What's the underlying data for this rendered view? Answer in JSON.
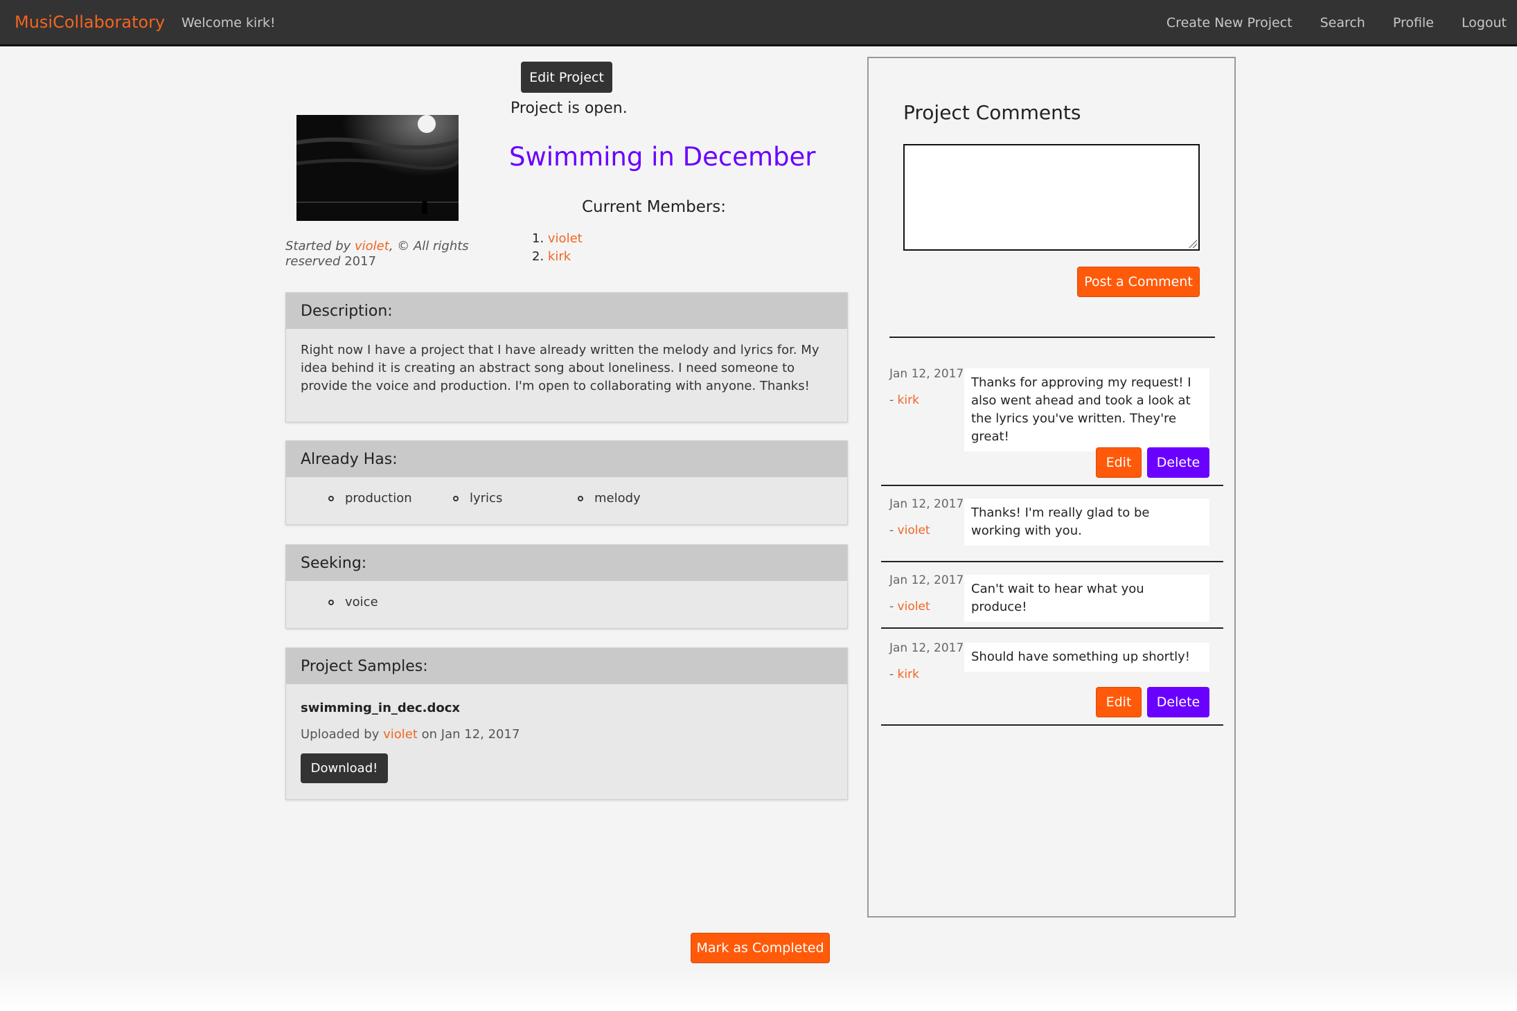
{
  "nav": {
    "brand": "MusiCollaboratory",
    "welcome": "Welcome kirk!",
    "links": [
      "Create New Project",
      "Search",
      "Profile",
      "Logout"
    ]
  },
  "project": {
    "edit_label": "Edit Project",
    "status": "Project is open.",
    "title": "Swimming in December",
    "started_prefix": "Started by ",
    "started_user": "violet",
    "started_suffix": ", © All rights reserved",
    "year": " 2017",
    "members_heading": "Current Members:",
    "members": [
      "violet",
      "kirk"
    ]
  },
  "description": {
    "heading": "Description:",
    "text": "Right now I have a project that I have already written the melody and lyrics for. My idea behind it is creating an abstract song about loneliness. I need someone to provide the voice and production. I'm open to collaborating with anyone. Thanks!"
  },
  "already_has": {
    "heading": "Already Has:",
    "items": [
      "production",
      "lyrics",
      "melody"
    ]
  },
  "seeking": {
    "heading": "Seeking:",
    "items": [
      "voice"
    ]
  },
  "samples": {
    "heading": "Project Samples:",
    "file_name": "swimming_in_dec.docx",
    "uploaded_prefix": "Uploaded by ",
    "uploaded_user": "violet",
    "uploaded_suffix": " on Jan 12, 2017",
    "download_label": "Download!"
  },
  "comments": {
    "heading": "Project Comments",
    "post_label": "Post a Comment",
    "edit_label": "Edit",
    "delete_label": "Delete",
    "items": [
      {
        "date": "Jan 12, 2017",
        "author": "kirk",
        "text": "Thanks for approving my request! I also went ahead and took a look at the lyrics you've written. They're great!"
      },
      {
        "date": "Jan 12, 2017",
        "author": "violet",
        "text": "Thanks! I'm really glad to be working with you."
      },
      {
        "date": "Jan 12, 2017",
        "author": "violet",
        "text": "Can't wait to hear what you produce!"
      },
      {
        "date": "Jan 12, 2017",
        "author": "kirk",
        "text": "Should have something up shortly!"
      }
    ]
  },
  "complete_label": "Mark as Completed",
  "colors": {
    "accent_orange": "#ff5a0a",
    "accent_purple": "#6a00ff",
    "navbar": "#333333"
  }
}
